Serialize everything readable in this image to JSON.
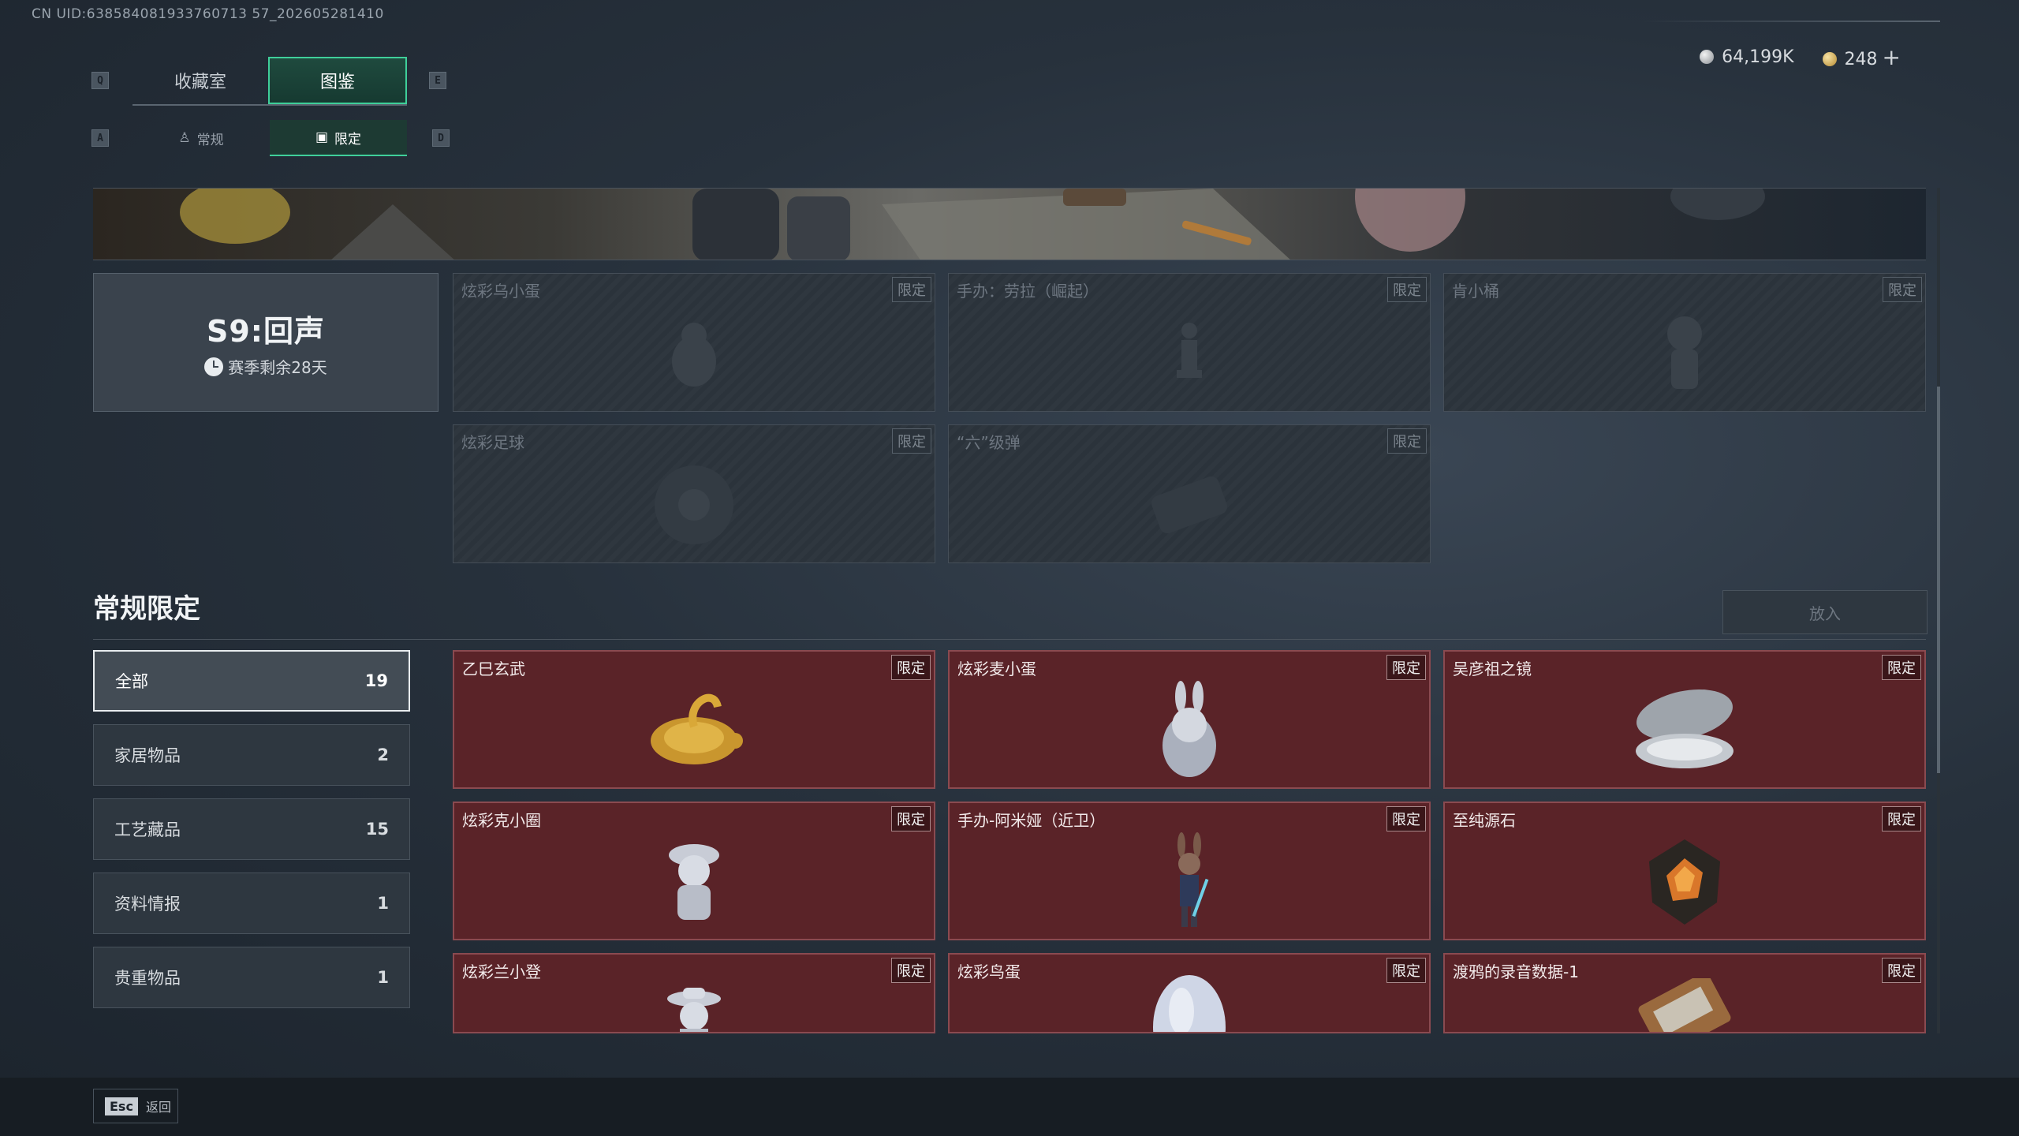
{
  "uid": "CN UID:638584081933760713 57_202605281410",
  "keys": {
    "q": "Q",
    "e": "E",
    "a": "A",
    "d": "D"
  },
  "tabs_main": [
    {
      "label": "收藏室"
    },
    {
      "label": "图鉴"
    }
  ],
  "tabs_sub": [
    {
      "label": "常规"
    },
    {
      "label": "限定"
    }
  ],
  "currency": {
    "silver": "64,199K",
    "gold": "248",
    "plus": "+"
  },
  "season": {
    "title": "S9:回声",
    "remaining": "赛季剩余28天"
  },
  "season_items": [
    {
      "name": "炫彩乌小蛋",
      "tag": "限定"
    },
    {
      "name": "手办：劳拉（崛起）",
      "tag": "限定"
    },
    {
      "name": "肯小桶",
      "tag": "限定"
    },
    {
      "name": "炫彩足球",
      "tag": "限定"
    },
    {
      "name": "“六”级弹",
      "tag": "限定"
    }
  ],
  "section": {
    "title": "常规限定",
    "put_button": "放入"
  },
  "categories": [
    {
      "label": "全部",
      "count": "19"
    },
    {
      "label": "家居物品",
      "count": "2"
    },
    {
      "label": "工艺藏品",
      "count": "15"
    },
    {
      "label": "资料情报",
      "count": "1"
    },
    {
      "label": "贵重物品",
      "count": "1"
    }
  ],
  "items": [
    {
      "name": "乙巳玄武",
      "tag": "限定"
    },
    {
      "name": "炫彩麦小蛋",
      "tag": "限定"
    },
    {
      "name": "吴彦祖之镜",
      "tag": "限定"
    },
    {
      "name": "炫彩克小圈",
      "tag": "限定"
    },
    {
      "name": "手办-阿米娅（近卫）",
      "tag": "限定"
    },
    {
      "name": "至纯源石",
      "tag": "限定"
    },
    {
      "name": "炫彩兰小登",
      "tag": "限定"
    },
    {
      "name": "炫彩鸟蛋",
      "tag": "限定"
    },
    {
      "name": "渡鸦的录音数据-1",
      "tag": "限定"
    }
  ],
  "footer": {
    "key": "Esc",
    "label": "返回"
  }
}
